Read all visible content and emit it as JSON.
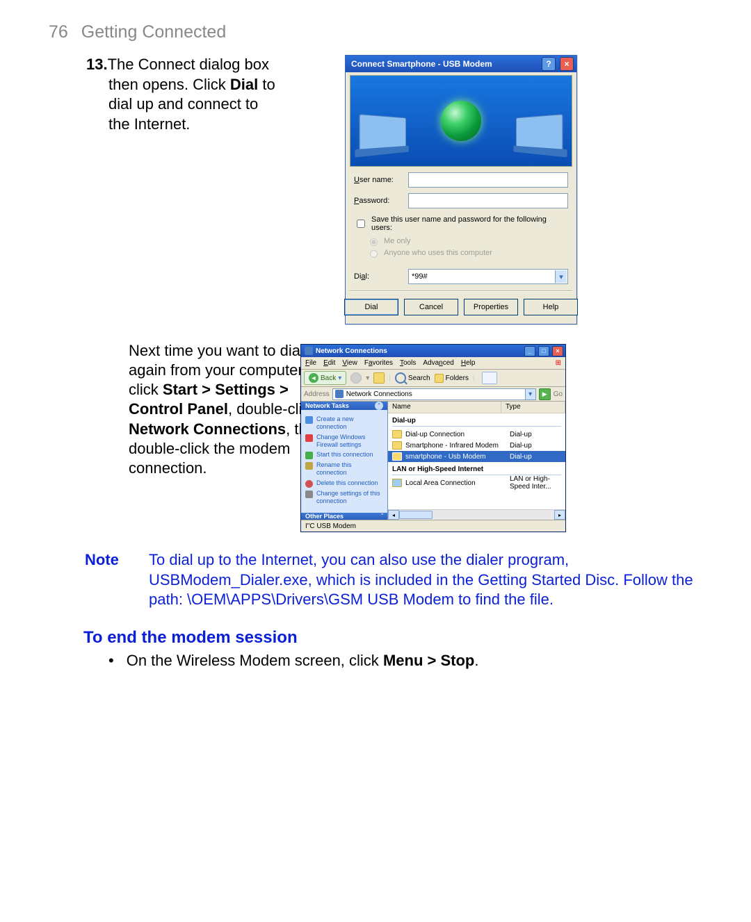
{
  "page": {
    "number": "76",
    "title": "Getting Connected"
  },
  "step13": {
    "number": "13.",
    "pre": "The Connect dialog box then opens. Click ",
    "bold": "Dial",
    "post": " to dial up and connect to the Internet."
  },
  "nextPara": {
    "p1": "Next time you want to dial up again from your computer, click ",
    "b1": "Start > Settings > Control Panel",
    "p2": ", double-click ",
    "b2": "Network Connections",
    "p3": ", then double-click the modem connection."
  },
  "note": {
    "label": "Note",
    "text": "To dial up to the Internet, you can also use the dialer program, USBModem_Dialer.exe, which is included in the Getting Started Disc. Follow the path: \\OEM\\APPS\\Drivers\\GSM USB Modem to find the file."
  },
  "endSection": {
    "heading": "To end the modem session",
    "bullet_pre": "On the Wireless Modem screen, click ",
    "bullet_bold": "Menu > Stop",
    "bullet_post": "."
  },
  "dialog": {
    "title": "Connect Smartphone - USB Modem",
    "username_label_u": "U",
    "username_label_rest": "ser name:",
    "password_label_u": "P",
    "password_label_rest": "assword:",
    "save_u": "S",
    "save_rest": "ave this user name and password for the following users:",
    "me_u": "o",
    "me_pre": "Me ",
    "me_rest": "nly",
    "anyone_u": "A",
    "anyone_rest": "nyone who uses this computer",
    "dial_label_u": "a",
    "dial_label_pre": "Di",
    "dial_label_post": "l:",
    "dial_value": "*99#",
    "btn_dial_u": "D",
    "btn_dial_rest": "ial",
    "btn_cancel": "Cancel",
    "btn_prop_u": "o",
    "btn_prop_pre": "Pr",
    "btn_prop_post": "perties",
    "btn_help_u": "H",
    "btn_help_rest": "elp"
  },
  "explorer": {
    "title": "Network Connections",
    "menus": {
      "file_u": "F",
      "file": "ile",
      "edit_u": "E",
      "edit": "dit",
      "view_u": "V",
      "view": "iew",
      "fav_pre": "F",
      "fav_u": "a",
      "fav_post": "vorites",
      "tools_u": "T",
      "tools": "ools",
      "adv_pre": "Adva",
      "adv_u": "n",
      "adv_post": "ced",
      "help_u": "H",
      "help": "elp"
    },
    "back": "Back",
    "search": "Search",
    "folders": "Folders",
    "addr_label_pre": "A",
    "addr_label_u": "d",
    "addr_label_post": "dress",
    "addr_value": "Network Connections",
    "go": "Go",
    "side_tasks_h": "Network Tasks",
    "tasks": [
      "Create a new connection",
      "Change Windows Firewall settings",
      "Start this connection",
      "Rename this connection",
      "Delete this connection",
      "Change settings of this connection"
    ],
    "side_other_h": "Other Places",
    "col_name": "Name",
    "col_type": "Type",
    "group1": "Dial-up",
    "items1": [
      {
        "name": "Dial-up Connection",
        "type": "Dial-up"
      },
      {
        "name": "Smartphone - Infrared Modem",
        "type": "Dial-up"
      },
      {
        "name": "smartphone - Usb Modem",
        "type": "Dial-up"
      }
    ],
    "group2": "LAN or High-Speed Internet",
    "items2": [
      {
        "name": "Local Area Connection",
        "type": "LAN or High-Speed Inter..."
      }
    ],
    "status": "I\"C USB Modem"
  }
}
